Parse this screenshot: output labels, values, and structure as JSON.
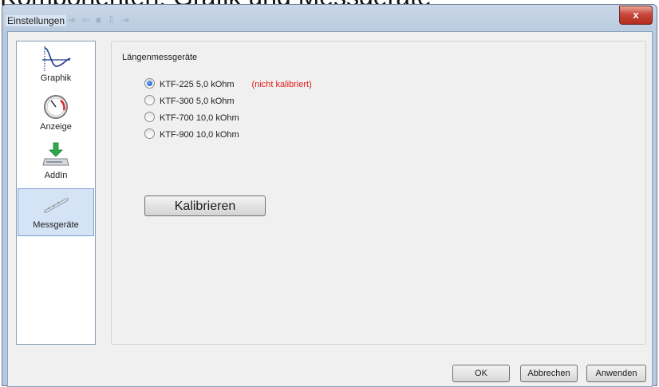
{
  "background_caption": "Komponenten: Grafik und Messgeräte",
  "window": {
    "title": "Einstellungen",
    "title_ghost": "➔ ⇦ ■ ⇩ ⇥",
    "close_label": "x"
  },
  "sidebar": {
    "items": [
      {
        "label": "Graphik",
        "icon": "graph-curve-icon",
        "selected": false
      },
      {
        "label": "Anzeige",
        "icon": "gauge-icon",
        "selected": false
      },
      {
        "label": "AddIn",
        "icon": "addin-download-icon",
        "selected": false
      },
      {
        "label": "Messgeräte",
        "icon": "measuring-rod-icon",
        "selected": true
      }
    ]
  },
  "group": {
    "title": "Längenmessgeräte",
    "options": [
      {
        "label": "KTF-225  5,0 kOhm",
        "checked": true,
        "note": "(nicht kalibriert)"
      },
      {
        "label": "KTF-300  5,0 kOhm",
        "checked": false,
        "note": ""
      },
      {
        "label": "KTF-700  10,0 kOhm",
        "checked": false,
        "note": ""
      },
      {
        "label": "KTF-900  10,0 kOhm",
        "checked": false,
        "note": ""
      }
    ],
    "calibrate_label": "Kalibrieren"
  },
  "footer": {
    "ok_label": "OK",
    "cancel_label": "Abbrechen",
    "apply_label": "Anwenden"
  },
  "colors": {
    "note_red": "#e21e1e",
    "selection_blue": "#d5e3f7",
    "close_red": "#c8473a"
  }
}
